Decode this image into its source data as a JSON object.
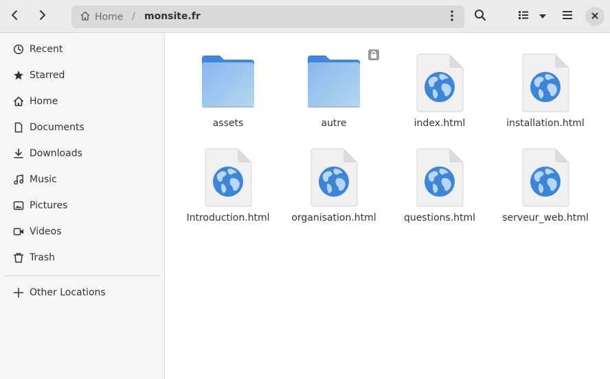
{
  "header": {
    "back_icon": "go-previous-icon",
    "forward_icon": "go-next-icon",
    "path": {
      "home_label": "Home",
      "separator": "/",
      "current": "monsite.fr"
    },
    "search_icon": "search-icon",
    "view_icon": "list-view-icon",
    "view_dropdown_icon": "chevron-down-icon",
    "menu_icon": "hamburger-menu-icon",
    "close_icon": "close-icon"
  },
  "sidebar": {
    "items": [
      {
        "label": "Recent",
        "icon": "recent-icon"
      },
      {
        "label": "Starred",
        "icon": "star-icon"
      },
      {
        "label": "Home",
        "icon": "home-icon"
      },
      {
        "label": "Documents",
        "icon": "document-icon"
      },
      {
        "label": "Downloads",
        "icon": "download-icon"
      },
      {
        "label": "Music",
        "icon": "music-icon"
      },
      {
        "label": "Pictures",
        "icon": "picture-icon"
      },
      {
        "label": "Videos",
        "icon": "video-icon"
      },
      {
        "label": "Trash",
        "icon": "trash-icon"
      }
    ],
    "other_locations": {
      "label": "Other Locations",
      "icon": "plus-icon"
    }
  },
  "files": [
    {
      "name": "assets",
      "type": "folder"
    },
    {
      "name": "autre",
      "type": "folder",
      "locked": true
    },
    {
      "name": "index.html",
      "type": "html"
    },
    {
      "name": "installation.html",
      "type": "html"
    },
    {
      "name": "Introduction.html",
      "type": "html"
    },
    {
      "name": "organisation.html",
      "type": "html"
    },
    {
      "name": "questions.html",
      "type": "html"
    },
    {
      "name": "serveur_web.html",
      "type": "html"
    }
  ],
  "colors": {
    "folder": "#5b9ee6",
    "globe": "#3d85d8",
    "headerbar": "#ebebeb",
    "sidebar": "#f6f6f6"
  }
}
